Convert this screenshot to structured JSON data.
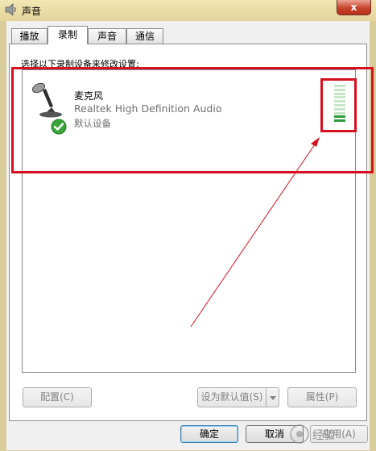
{
  "window": {
    "title": "声音",
    "close_label": "x"
  },
  "tabs": [
    {
      "label": "播放",
      "active": false
    },
    {
      "label": "录制",
      "active": true
    },
    {
      "label": "声音",
      "active": false
    },
    {
      "label": "通信",
      "active": false
    }
  ],
  "recording": {
    "instruction": "选择以下录制设备来修改设置:",
    "devices": [
      {
        "name": "麦克风",
        "driver": "Realtek High Definition Audio",
        "status": "默认设备",
        "icon": "microphone-icon",
        "status_icon": "green-check-icon",
        "level_fraction": 0.2
      }
    ]
  },
  "buttons": {
    "configure": "配置(C)",
    "set_default": "设为默认值(S)",
    "properties": "属性(P)",
    "ok": "确定",
    "cancel": "取消",
    "apply": "应用(A)"
  },
  "colors": {
    "annotation_red": "#d6101e",
    "level_active": "#2e9a3c",
    "level_inactive": "#c7e6c9",
    "check_green": "#3aa43a"
  }
}
